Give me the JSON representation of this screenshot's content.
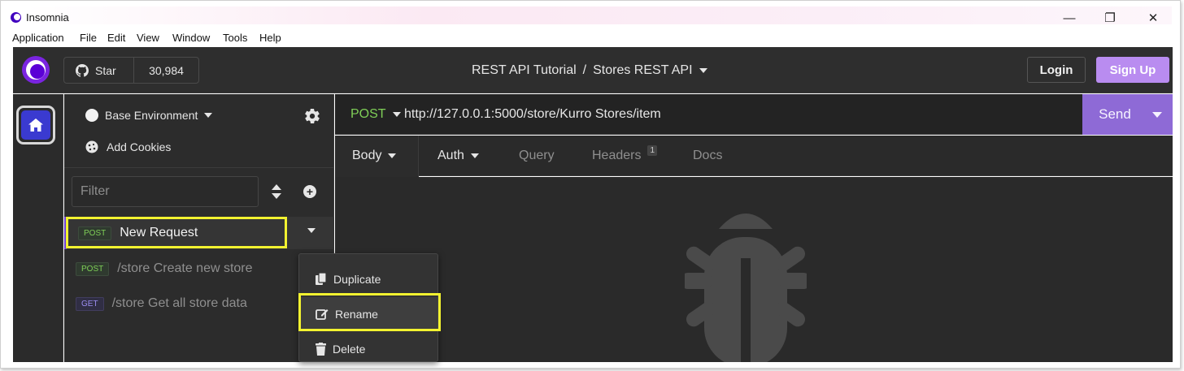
{
  "window": {
    "title": "Insomnia",
    "controls": {
      "minimize": "—",
      "restore": "❐",
      "close": "✕"
    }
  },
  "menu": [
    "Application",
    "File",
    "Edit",
    "View",
    "Window",
    "Tools",
    "Help"
  ],
  "header": {
    "star_label": "Star",
    "star_count": "30,984",
    "breadcrumb_project": "REST API Tutorial",
    "breadcrumb_sep": "/",
    "breadcrumb_collection": "Stores REST API",
    "login_label": "Login",
    "signup_label": "Sign Up"
  },
  "sidebar": {
    "environment": "Base Environment",
    "cookies": "Add Cookies",
    "filter_placeholder": "Filter",
    "requests": [
      {
        "method": "POST",
        "name": "New Request",
        "active": true
      },
      {
        "method": "POST",
        "name": "/store Create new store",
        "active": false
      },
      {
        "method": "GET",
        "name": "/store Get all store data",
        "active": false
      }
    ]
  },
  "request": {
    "method": "POST",
    "url": "http://127.0.0.1:5000/store/Kurro Stores/item",
    "send_label": "Send",
    "tabs": [
      {
        "label": "Body",
        "has_dropdown": true,
        "active": true
      },
      {
        "label": "Auth",
        "has_dropdown": true,
        "active": false
      },
      {
        "label": "Query",
        "has_dropdown": false,
        "active": false
      },
      {
        "label": "Headers",
        "badge": "1",
        "active": false
      },
      {
        "label": "Docs",
        "has_dropdown": false,
        "active": false
      }
    ]
  },
  "context_menu": {
    "items": [
      {
        "label": "Duplicate",
        "icon": "duplicate-icon"
      },
      {
        "label": "Rename",
        "icon": "edit-icon",
        "hovered": true
      },
      {
        "label": "Delete",
        "icon": "trash-icon"
      }
    ]
  },
  "colors": {
    "accent": "#7a24e0",
    "send": "#8e6ad6",
    "signup": "#b98cf0",
    "post": "#7fcf57",
    "get": "#9b8df0",
    "highlight": "#f2f230"
  }
}
